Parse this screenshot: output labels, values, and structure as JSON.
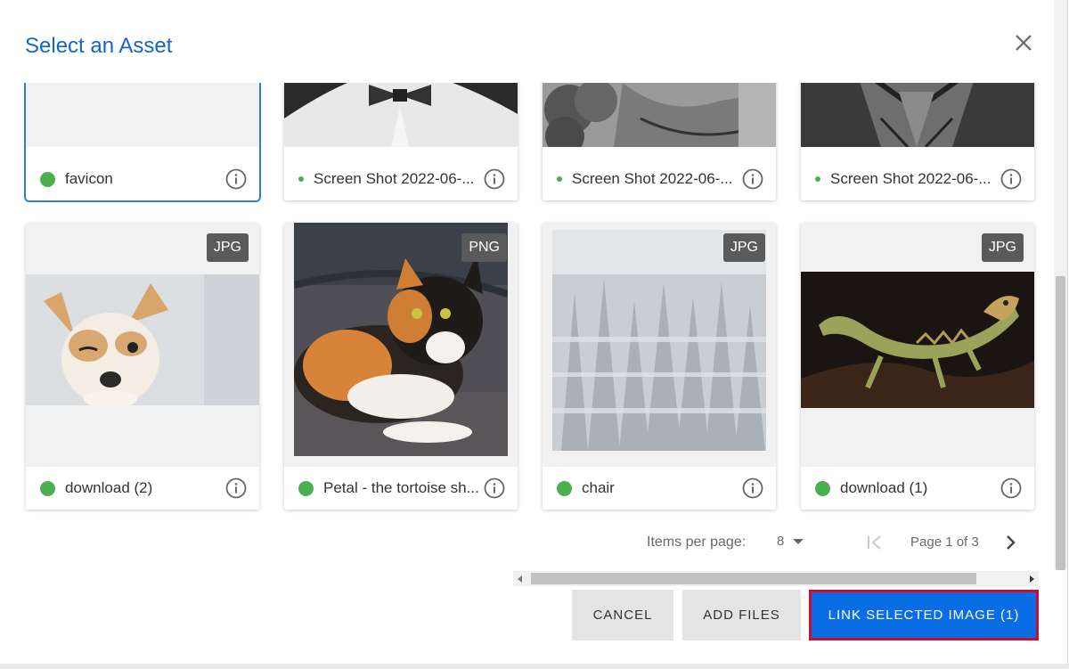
{
  "dialog": {
    "title": "Select an Asset",
    "close_icon": "close-icon"
  },
  "assets_top_row": [
    {
      "name": "favicon",
      "selected": true
    },
    {
      "name": "Screen Shot 2022-06-..."
    },
    {
      "name": "Screen Shot 2022-06-..."
    },
    {
      "name": "Screen Shot 2022-06-..."
    }
  ],
  "assets_bottom_row": [
    {
      "name": "download (2)",
      "type": "JPG",
      "image": "chihuahua-photo"
    },
    {
      "name": "Petal - the tortoise sh...",
      "type": "PNG",
      "image": "calico-cat-photo"
    },
    {
      "name": "chair",
      "type": "JPG",
      "image": "snowy-forest-photo"
    },
    {
      "name": "download (1)",
      "type": "JPG",
      "image": "lizard-photo"
    }
  ],
  "pagination": {
    "items_per_page_label": "Items per page:",
    "items_per_page_value": "8",
    "page_info": "Page 1 of 3"
  },
  "actions": {
    "cancel": "CANCEL",
    "add_files": "ADD FILES",
    "link_selected": "LINK SELECTED IMAGE (1)"
  },
  "colors": {
    "title": "#1366c6",
    "status_ok": "#4caf50",
    "primary_button": "#0a6de6",
    "highlight_outline": "#c8102e",
    "badge": "#5a5a5a"
  }
}
